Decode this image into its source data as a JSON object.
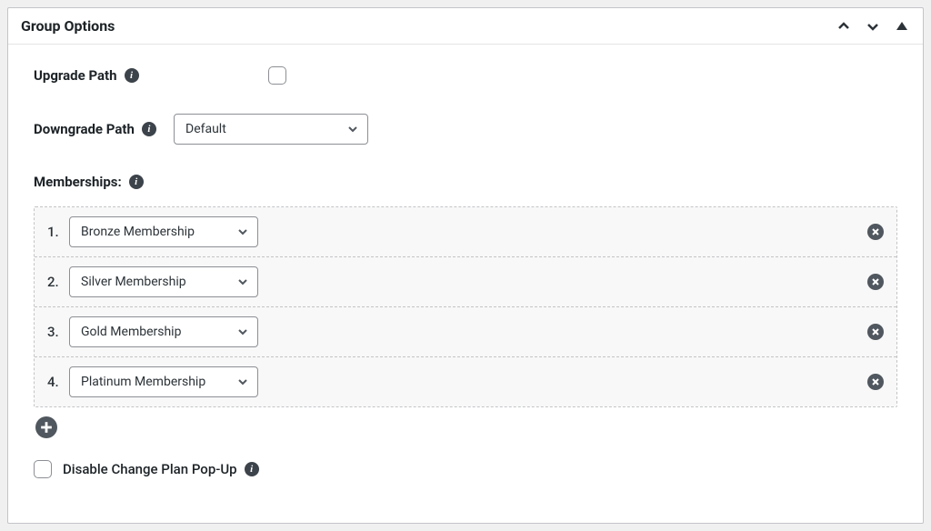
{
  "panel": {
    "title": "Group Options"
  },
  "fields": {
    "upgrade_path_label": "Upgrade Path",
    "downgrade_path_label": "Downgrade Path",
    "downgrade_path_value": "Default",
    "memberships_label": "Memberships:",
    "memberships": [
      {
        "index": "1.",
        "name": "Bronze Membership"
      },
      {
        "index": "2.",
        "name": "Silver Membership"
      },
      {
        "index": "3.",
        "name": "Gold Membership"
      },
      {
        "index": "4.",
        "name": "Platinum Membership"
      }
    ],
    "disable_popup_label": "Disable Change Plan Pop-Up"
  }
}
